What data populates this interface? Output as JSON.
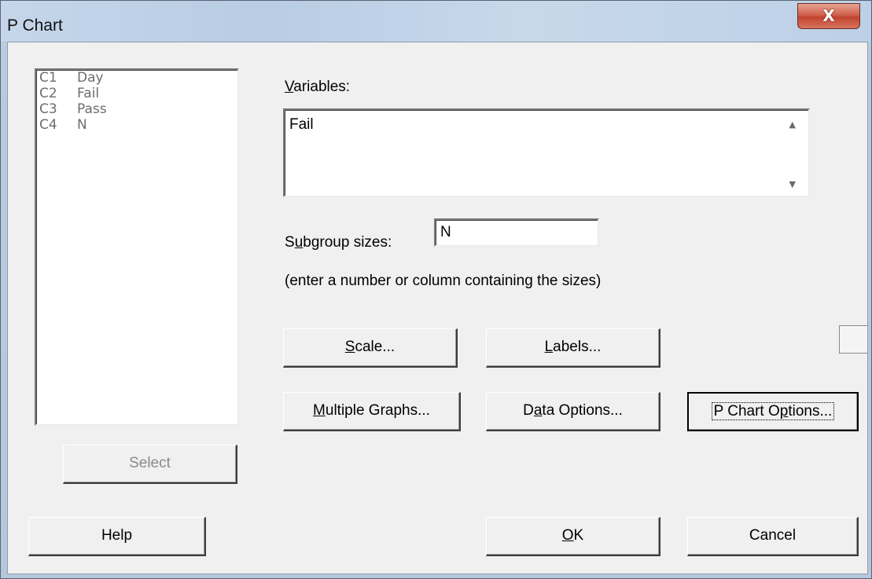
{
  "window": {
    "title": "P Chart",
    "close_glyph": "X"
  },
  "columns": [
    {
      "id": "C1",
      "name": "Day"
    },
    {
      "id": "C2",
      "name": "Fail"
    },
    {
      "id": "C3",
      "name": "Pass"
    },
    {
      "id": "C4",
      "name": "N"
    }
  ],
  "variables": {
    "label_mnemonic": "V",
    "label_rest": "ariables:",
    "value": "Fail"
  },
  "subgroup": {
    "label_pre": "S",
    "label_mnemonic": "u",
    "label_rest": "bgroup sizes:",
    "value": "N",
    "hint": "(enter a number or column containing the sizes)"
  },
  "buttons": {
    "scale": {
      "mnemonic": "S",
      "rest": "cale..."
    },
    "labels": {
      "mnemonic": "L",
      "rest": "abels..."
    },
    "multiple_graphs": {
      "mnemonic": "M",
      "rest": "ultiple Graphs..."
    },
    "data_options": {
      "pre": "D",
      "mnemonic": "a",
      "rest": "ta Options..."
    },
    "p_chart_options": {
      "pre": "P Chart O",
      "mnemonic": "p",
      "rest": "tions..."
    },
    "select": "Select",
    "help": "Help",
    "ok": {
      "mnemonic": "O",
      "rest": "K"
    },
    "cancel": "Cancel"
  },
  "icons": {
    "close": "close-icon",
    "scroll_up": "scroll-up-arrow-icon",
    "scroll_down": "scroll-down-arrow-icon"
  }
}
